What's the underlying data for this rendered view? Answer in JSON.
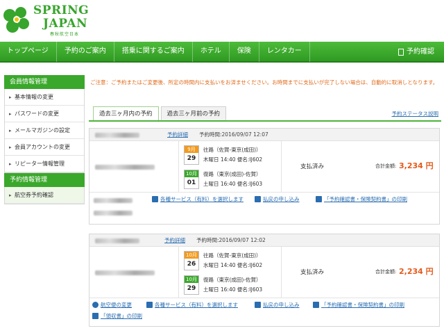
{
  "brand": {
    "name_line1": "SPRING",
    "name_line2": "JAPAN",
    "sub": "春秋航空日本",
    "colors": {
      "green": "#3aa82b",
      "orange": "#e5581a"
    }
  },
  "nav": {
    "items": [
      "トップページ",
      "予約のご案内",
      "搭乗に関するご案内",
      "ホテル",
      "保険",
      "レンタカー"
    ],
    "right": "予約確認"
  },
  "sidebar": {
    "section1": "会員情報管理",
    "items1": [
      "基本情報の変更",
      "パスワードの変更",
      "メールマガジンの設定",
      "会員アカウントの変更",
      "リピーター情報管理"
    ],
    "section2": "予約情報管理",
    "items2": [
      "航空券予約確認"
    ]
  },
  "main": {
    "notice": "ご注意：ご予約またはご変更後、所定の時間内に支払いをお済ませください。お時間までに支払いが完了しない場合は、自動的に取消しとなります。",
    "tabs": [
      "過去三ヶ月内の予約",
      "過去三ヶ月前の予約"
    ],
    "status_link": "予約ステータス説明"
  },
  "bookings": [
    {
      "detail": "予約詳細",
      "booked_at": "予約時間:2016/09/07 12:07",
      "outbound": {
        "month": "9月",
        "day": "29",
        "route": "往路（佐賀-東京(成田)）",
        "time": "木曜日 14:40 便名:IJ602"
      },
      "return": {
        "month": "10月",
        "day": "01",
        "route": "復路（東京(成田)-佐賀）",
        "time": "土曜日 16:40 便名:IJ603"
      },
      "status": "支払済み",
      "total_label": "合計金額:",
      "total": "3,234 円",
      "actions": [
        "各種サービス（有料）を選択します",
        "払戻の申し込み",
        "「予約確認書・保険契約書」の印刷"
      ]
    },
    {
      "detail": "予約詳細",
      "booked_at": "予約時間:2016/09/07 12:02",
      "outbound": {
        "month": "10月",
        "day": "26",
        "route": "往路（佐賀-東京(成田)）",
        "time": "水曜日 14:40 便名:IJ602"
      },
      "return": {
        "month": "10月",
        "day": "29",
        "route": "復路（東京(成田)-佐賀）",
        "time": "土曜日 16:40 便名:IJ603"
      },
      "status": "支払済み",
      "total_label": "合計金額:",
      "total": "2,234 円",
      "actions": [
        "航空便の変更",
        "各種サービス（有料）を選択します",
        "払戻の申し込み",
        "「予約確認書・保険契約書」の印刷",
        "「領収書」の印刷"
      ]
    }
  ]
}
